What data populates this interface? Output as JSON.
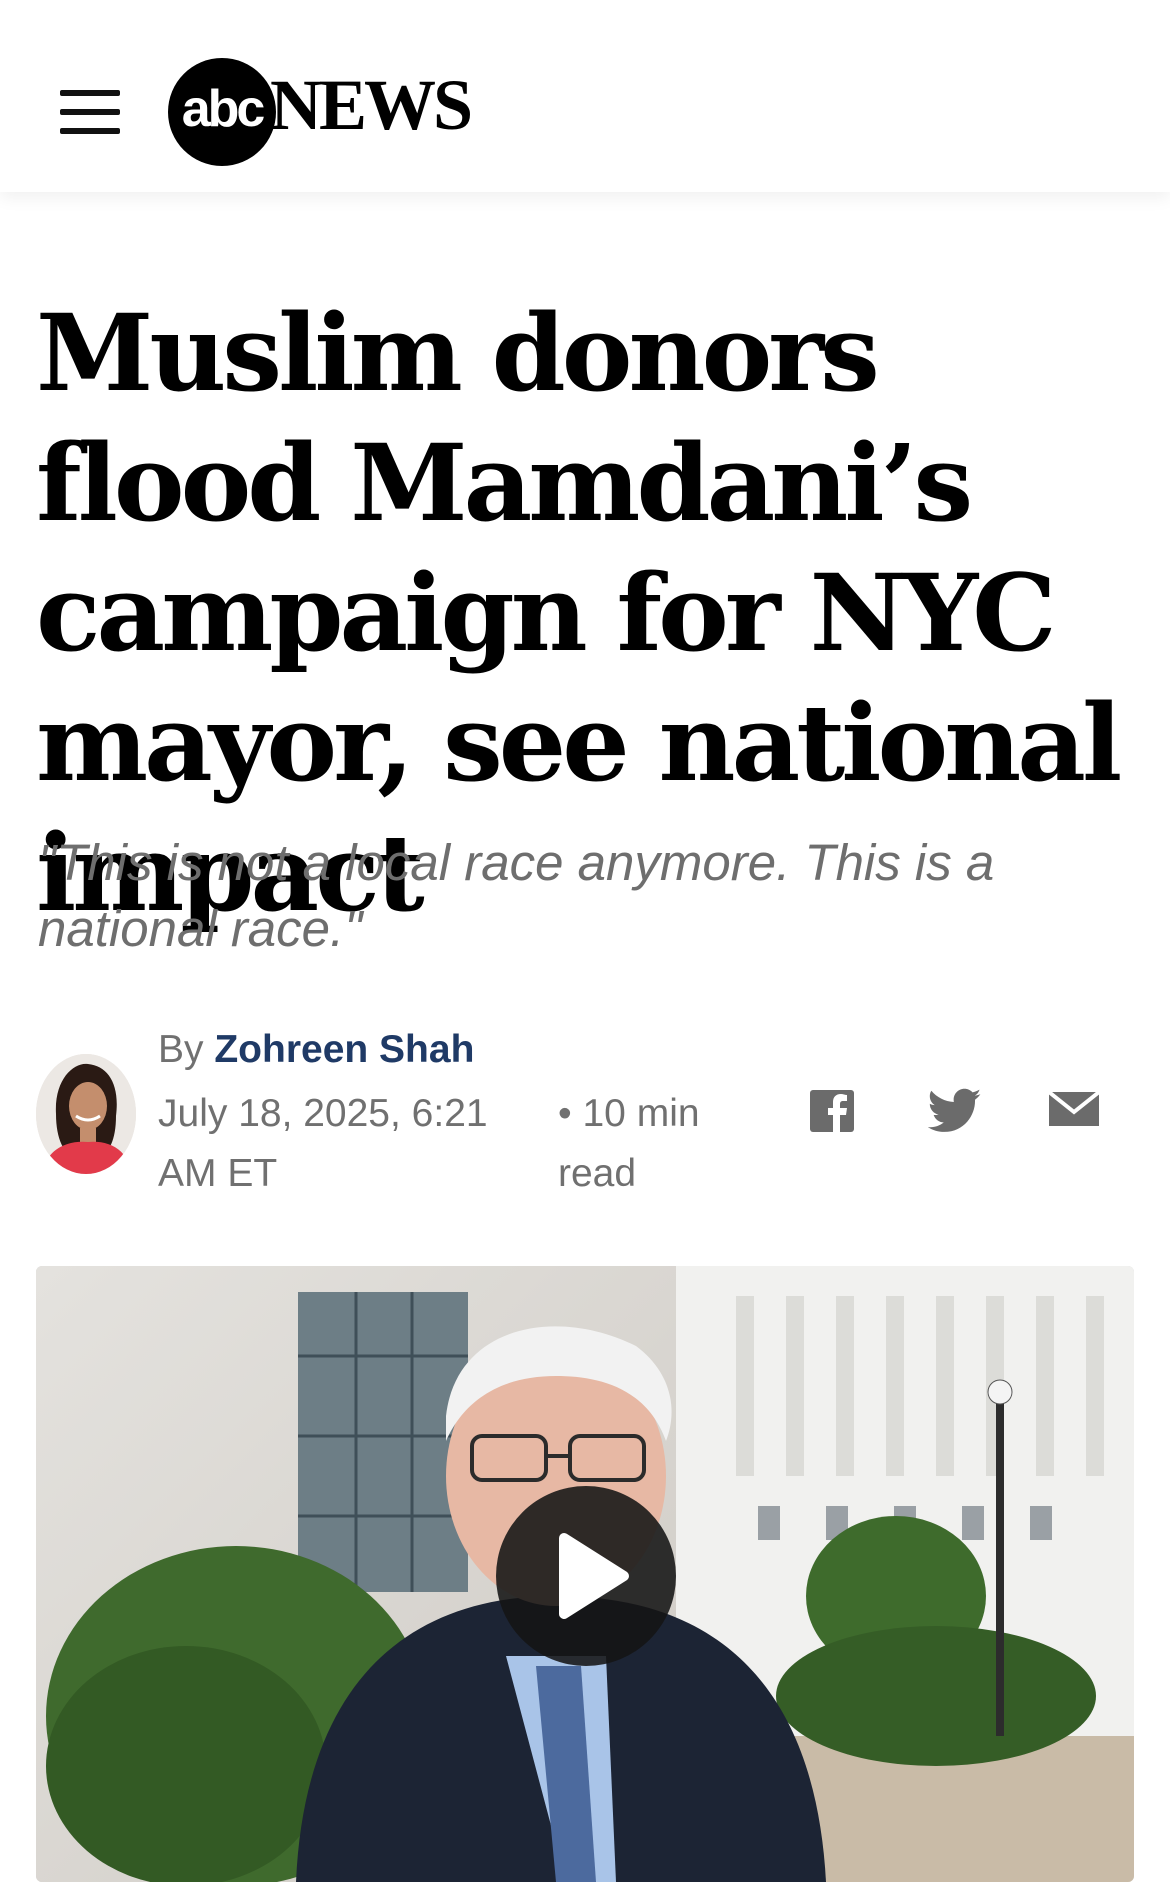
{
  "header": {
    "logo_abc": "abc",
    "logo_news": "NEWS",
    "menu_icon": "hamburger-menu-icon"
  },
  "article": {
    "headline": "Muslim donors flood Mamdani’s campaign for NYC mayor, see national impact",
    "dek": "\"This is not a local race anymore. This is a national race.\"",
    "byline_prefix": "By",
    "author": "Zohreen Shah",
    "date": "July 18, 2025, 6:21 AM ET",
    "read_time": "• 10 min read"
  },
  "share": {
    "icons": [
      "facebook-icon",
      "twitter-icon",
      "email-icon"
    ]
  },
  "video": {
    "play_icon": "play-icon"
  },
  "colors": {
    "author_link": "#1f3a66",
    "meta_text": "#707070",
    "dek_text": "#6e6e6e"
  }
}
